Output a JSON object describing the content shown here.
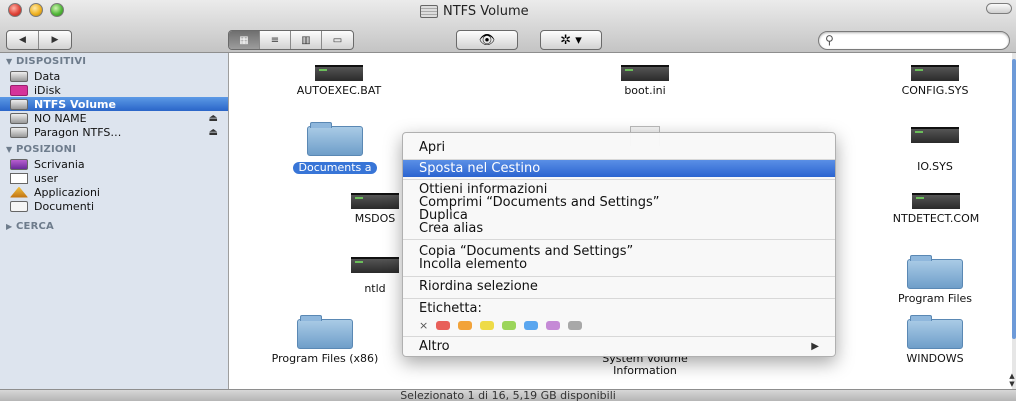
{
  "window": {
    "title": "NTFS Volume"
  },
  "toolbar": {
    "back_glyph": "◀",
    "forward_glyph": "▶",
    "view_modes": [
      "▦",
      "≡",
      "▥",
      "▭"
    ],
    "quicklook_glyph": "👁",
    "action_glyph": "✲ ▾",
    "search": {
      "value": "",
      "placeholder": ""
    }
  },
  "sidebar": {
    "sections": [
      {
        "label": "DISPOSITIVI"
      },
      {
        "label": "POSIZIONI"
      },
      {
        "label": "CERCA"
      }
    ],
    "devices": [
      {
        "label": "Data",
        "icon": "drive-icon"
      },
      {
        "label": "iDisk",
        "icon": "idisk-icon"
      },
      {
        "label": "NTFS Volume",
        "icon": "drive-icon",
        "selected": true
      },
      {
        "label": "NO NAME",
        "icon": "drive-icon",
        "eject": true
      },
      {
        "label": "Paragon NTFS…",
        "icon": "drive-icon",
        "eject": true
      }
    ],
    "places": [
      {
        "label": "Scrivania",
        "icon": "desktop-icon"
      },
      {
        "label": "user",
        "icon": "home-icon"
      },
      {
        "label": "Applicazioni",
        "icon": "applications-icon"
      },
      {
        "label": "Documenti",
        "icon": "documents-folder-icon"
      }
    ]
  },
  "files": [
    {
      "name": "AUTOEXEC.BAT",
      "type": "exec"
    },
    {
      "name": "boot.ini",
      "type": "exec"
    },
    {
      "name": "CONFIG.SYS",
      "type": "exec"
    },
    {
      "name": "Documents a",
      "type": "folder",
      "selected": true
    },
    {
      "name": "",
      "type": "document"
    },
    {
      "name": "IO.SYS",
      "type": "exec"
    },
    {
      "name": "MSDOS",
      "type": "exec"
    },
    {
      "name": "NTDETECT.COM",
      "type": "exec"
    },
    {
      "name": "ntld",
      "type": "exec"
    },
    {
      "name": "Program Files",
      "type": "folder"
    },
    {
      "name": "Program Files (x86)",
      "type": "folder"
    },
    {
      "name": "System Volume Information",
      "type": "folder"
    },
    {
      "name": "WINDOWS",
      "type": "folder"
    }
  ],
  "context_menu": {
    "items": [
      "Apri",
      "Sposta nel Cestino",
      "Ottieni informazioni",
      "Comprimi “Documents and Settings”",
      "Duplica",
      "Crea alias",
      "Copia “Documents and Settings”",
      "Incolla elemento",
      "Riordina selezione",
      "Etichetta:",
      "Altro"
    ],
    "highlighted_index": 1,
    "label_colors": [
      "#e8605a",
      "#f2a33a",
      "#eedb47",
      "#9bd55a",
      "#5aa6ef",
      "#c58ad6",
      "#a8a8a8"
    ],
    "clear_label_glyph": "×",
    "submenu_glyph": "▶"
  },
  "status": {
    "text": "Selezionato 1 di 16, 5,19 GB disponibili"
  },
  "colors": {
    "selection": "#3875d7",
    "sidebar_bg": "#dde4ee"
  }
}
